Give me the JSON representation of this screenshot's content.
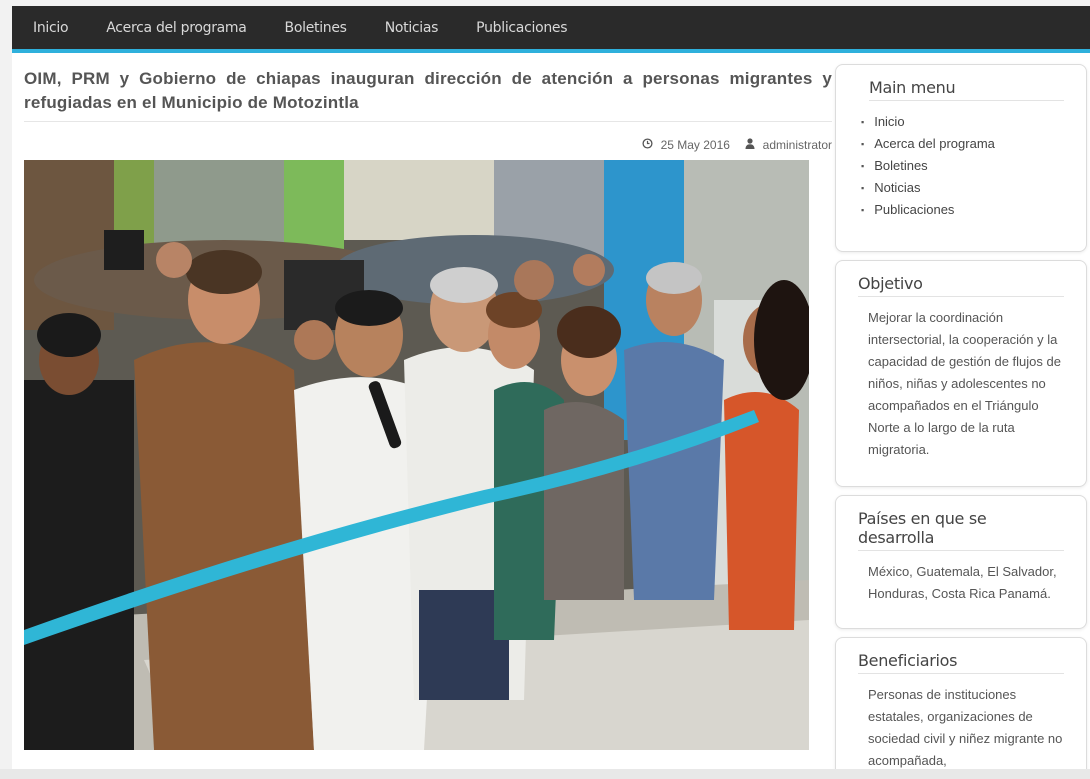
{
  "nav": {
    "items": [
      "Inicio",
      "Acerca del programa",
      "Boletines",
      "Noticias",
      "Publicaciones"
    ]
  },
  "article": {
    "title": "OIM, PRM y Gobierno de chiapas inauguran dirección de atención a personas migrantes y refugiadas en el Municipio de Motozintla",
    "date": "25 May 2016",
    "author": "administrator",
    "date_icon": "clock-icon",
    "author_icon": "user-icon"
  },
  "sidebar": {
    "main_menu": {
      "title": "Main menu",
      "items": [
        "Inicio",
        "Acerca del programa",
        "Boletines",
        "Noticias",
        "Publicaciones"
      ]
    },
    "objetivo": {
      "title": "Objetivo",
      "text": "Mejorar la coordinación intersectorial, la cooperación y la capacidad de gestión de flujos de niños, niñas y adolescentes no acompañados en el Triángulo Norte a lo largo de la ruta migratoria."
    },
    "paises": {
      "title": "Países en que se desarrolla",
      "text": "México, Guatemala, El Salvador, Honduras, Costa Rica Panamá."
    },
    "beneficiarios": {
      "title": "Beneficiarios",
      "text": "Personas de instituciones estatales, organizaciones de sociedad civil y niñez migrante no acompañada,"
    }
  },
  "colors": {
    "nav_bg": "#2a2a2a",
    "accent": "#2eb0dc",
    "ribbon": "#2fb6d6"
  }
}
